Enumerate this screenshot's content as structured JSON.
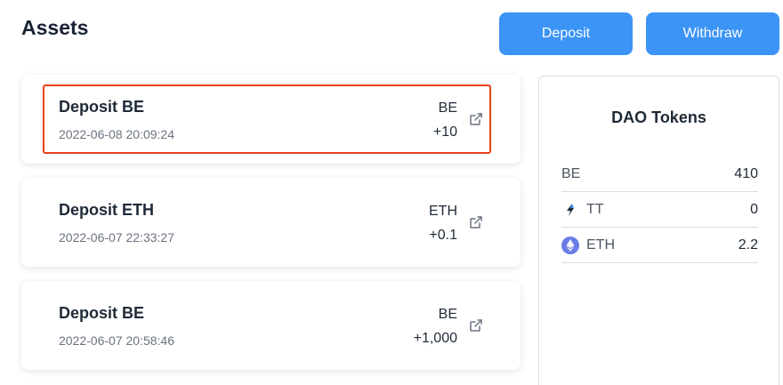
{
  "header": {
    "title": "Assets",
    "deposit_label": "Deposit",
    "withdraw_label": "Withdraw",
    "accent_color": "#3b94f6"
  },
  "transactions": [
    {
      "title": "Deposit BE",
      "time": "2022-06-08 20:09:24",
      "token": "BE",
      "amount": "+10",
      "highlighted": true,
      "link_icon": "external-link-icon"
    },
    {
      "title": "Deposit ETH",
      "time": "2022-06-07 22:33:27",
      "token": "ETH",
      "amount": "+0.1",
      "highlighted": false,
      "link_icon": "external-link-icon"
    },
    {
      "title": "Deposit BE",
      "time": "2022-06-07 20:58:46",
      "token": "BE",
      "amount": "+1,000",
      "highlighted": false,
      "link_icon": "external-link-icon"
    }
  ],
  "dao_tokens": {
    "title": "DAO Tokens",
    "items": [
      {
        "name": "BE",
        "value": "410",
        "icon": ""
      },
      {
        "name": "TT",
        "value": "0",
        "icon": "tt-token-icon"
      },
      {
        "name": "ETH",
        "value": "2.2",
        "icon": "eth-icon"
      }
    ]
  },
  "highlight_color": "#e8401c"
}
